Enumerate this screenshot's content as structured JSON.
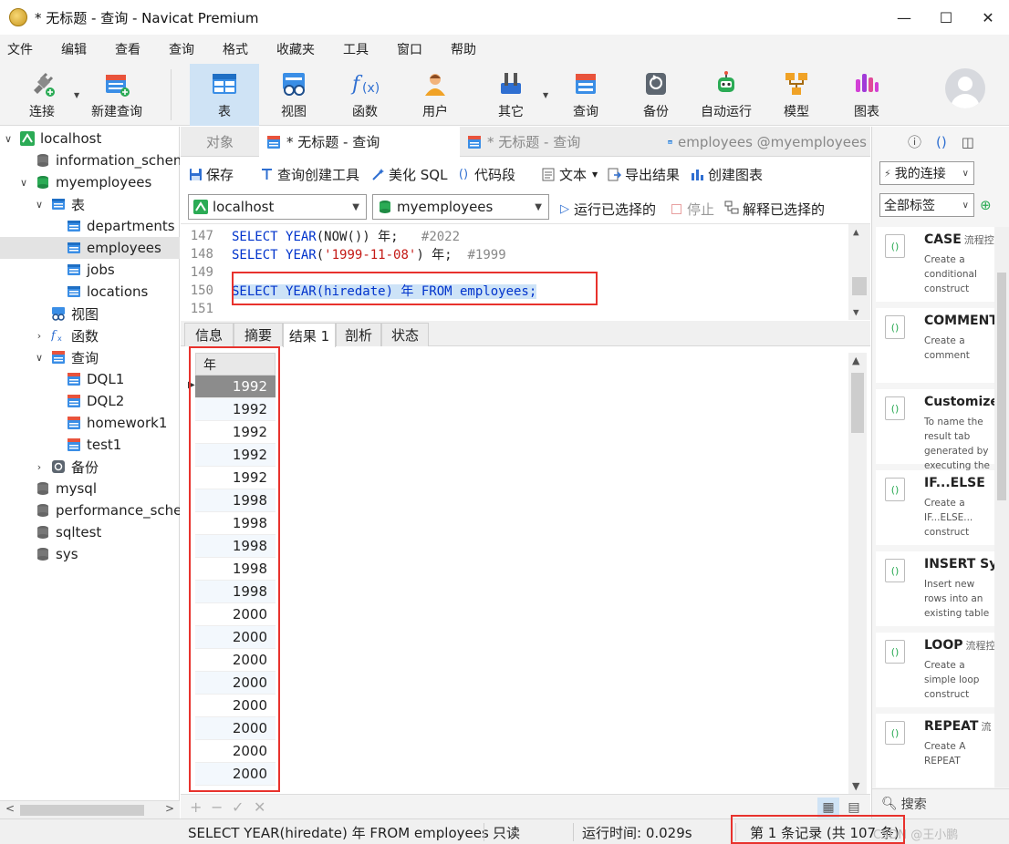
{
  "window": {
    "title": "* 无标题 - 查询 - Navicat Premium",
    "minimize": "—",
    "maximize": "☐",
    "close": "✕"
  },
  "menu": [
    "文件",
    "编辑",
    "查看",
    "查询",
    "格式",
    "收藏夹",
    "工具",
    "窗口",
    "帮助"
  ],
  "toolbar": {
    "connect": "连接",
    "new_query": "新建查询",
    "table": "表",
    "view": "视图",
    "function": "函数",
    "user": "用户",
    "others": "其它",
    "query": "查询",
    "backup": "备份",
    "automation": "自动运行",
    "model": "模型",
    "chart": "图表"
  },
  "tree": [
    {
      "label": "localhost",
      "arrow": "∨"
    },
    {
      "label": "information_schema"
    },
    {
      "label": "myemployees",
      "arrow": "∨"
    },
    {
      "label": "表",
      "arrow": "∨"
    },
    {
      "label": "departments"
    },
    {
      "label": "employees"
    },
    {
      "label": "jobs"
    },
    {
      "label": "locations"
    },
    {
      "label": "视图",
      "arrow": ""
    },
    {
      "label": "函数",
      "arrow": "›"
    },
    {
      "label": "查询",
      "arrow": "∨"
    },
    {
      "label": "DQL1"
    },
    {
      "label": "DQL2"
    },
    {
      "label": "homework1"
    },
    {
      "label": "test1"
    },
    {
      "label": "备份",
      "arrow": "›"
    },
    {
      "label": "mysql"
    },
    {
      "label": "performance_schema"
    },
    {
      "label": "sqltest"
    },
    {
      "label": "sys"
    }
  ],
  "tabs": {
    "objects": "对象",
    "active": "* 无标题 - 查询",
    "inactive": "* 无标题 - 查询",
    "employees": "employees @myemployees"
  },
  "query_toolbar": {
    "save": "保存",
    "query_builder": "查询创建工具",
    "beautify": "美化 SQL",
    "snippet": "代码段",
    "text": "文本",
    "export": "导出结果",
    "create_chart": "创建图表"
  },
  "connection": {
    "server": "localhost",
    "database": "myemployees",
    "run_selected": "运行已选择的",
    "stop": "停止",
    "explain_selected": "解释已选择的"
  },
  "editor": {
    "lines": [
      {
        "n": "147",
        "pre": "SELECT ",
        "kw1": "YEAR",
        "mid": "(NOW()) 年;   ",
        "str": "",
        "tail": "",
        "cmt": "#2022"
      },
      {
        "n": "148",
        "pre": "SELECT ",
        "kw1": "YEAR",
        "mid": "(",
        "str": "'1999-11-08'",
        "tail": ") 年;  ",
        "cmt": "#1999"
      },
      {
        "n": "149"
      },
      {
        "n": "150",
        "selected": "SELECT YEAR(hiredate) 年 FROM employees;"
      },
      {
        "n": "151"
      }
    ]
  },
  "result_tabs": [
    "信息",
    "摘要",
    "结果 1",
    "剖析",
    "状态"
  ],
  "grid": {
    "column": "年",
    "rows": [
      "1992",
      "1992",
      "1992",
      "1992",
      "1992",
      "1998",
      "1998",
      "1998",
      "1998",
      "1998",
      "2000",
      "2000",
      "2000",
      "2000",
      "2000",
      "2000",
      "2000",
      "2000"
    ],
    "current_row_index": 0
  },
  "grid_bar": {
    "add": "+",
    "remove": "−",
    "apply": "✓",
    "discard": "✕"
  },
  "right_panel": {
    "conn_select": "我的连接",
    "tag_select": "全部标签",
    "search": "搜索",
    "snippets": [
      {
        "title": "CASE",
        "tag": "流程控制",
        "desc": "Create a conditional construct"
      },
      {
        "title": "COMMENT",
        "tag": "",
        "desc": "Create a comment"
      },
      {
        "title": "Customize",
        "tag": "",
        "desc": "To name the result tab generated by executing the statement."
      },
      {
        "title": "IF...ELSE",
        "tag": "",
        "desc": "Create a IF...ELSE... construct"
      },
      {
        "title": "INSERT Sy",
        "tag": "",
        "desc": "Insert new rows into an existing table"
      },
      {
        "title": "LOOP",
        "tag": "流程控制",
        "desc": "Create a simple loop construct"
      },
      {
        "title": "REPEAT",
        "tag": "流",
        "desc": "Create A REPEAT"
      }
    ]
  },
  "status": {
    "sql": "SELECT YEAR(hiredate) 年 FROM employees",
    "readonly": "只读",
    "runtime": "运行时间: 0.029s",
    "record": "第 1 条记录 (共 107 条)",
    "watermark": "CSDN @王小鹏"
  },
  "colors": {
    "accent": "#cfe3f5",
    "highlight_box": "#e8322d",
    "keyword": "#0033cc",
    "string": "#c41a16",
    "comment": "#888888"
  }
}
